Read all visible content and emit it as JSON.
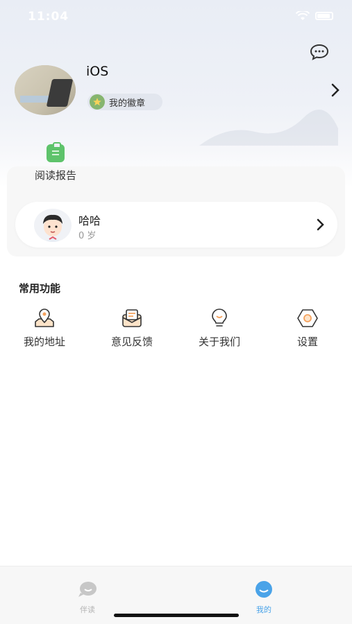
{
  "status": {
    "time": "11:04"
  },
  "profile": {
    "name": "iOS",
    "badge_label": "我的徽章"
  },
  "report": {
    "label": "阅读报告"
  },
  "child": {
    "name": "哈哈",
    "age": "0 岁"
  },
  "common": {
    "title": "常用功能",
    "items": [
      {
        "label": "我的地址",
        "icon": "location-icon"
      },
      {
        "label": "意见反馈",
        "icon": "feedback-icon"
      },
      {
        "label": "关于我们",
        "icon": "about-icon"
      },
      {
        "label": "设置",
        "icon": "settings-icon"
      }
    ]
  },
  "tabs": [
    {
      "label": "伴读",
      "icon": "read-along-icon",
      "active": false
    },
    {
      "label": "我的",
      "icon": "mine-icon",
      "active": true
    }
  ],
  "colors": {
    "accent": "#4aa3e8",
    "inactive": "#b5b5b5",
    "report_green": "#5ec36b",
    "icon_orange": "#f5a25d"
  }
}
